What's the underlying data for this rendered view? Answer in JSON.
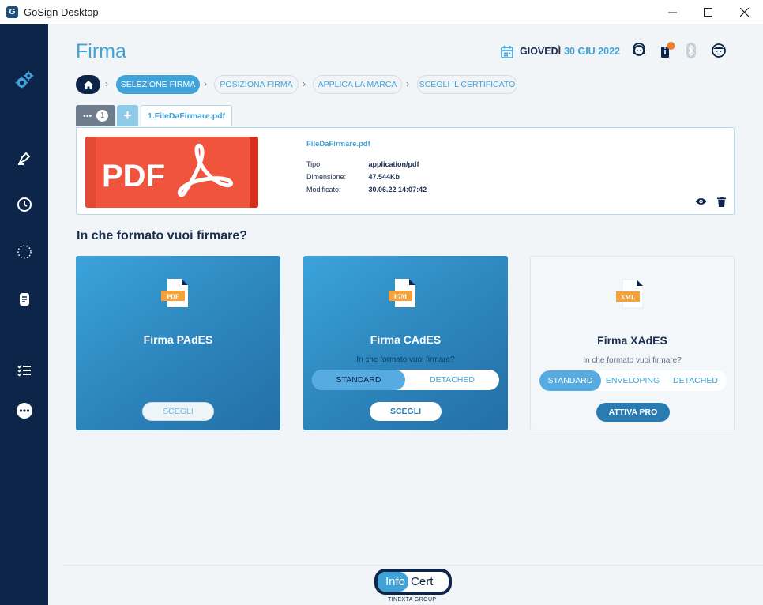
{
  "window": {
    "title": "GoSign Desktop",
    "app_icon_glyph": "G"
  },
  "header": {
    "title": "Firma",
    "date_day": "GIOVEDÌ",
    "date_value": "30 GIU 2022",
    "icons": [
      "calendar-icon",
      "support-agent-icon",
      "notifications-icon",
      "bluetooth-icon",
      "user-avatar-icon"
    ],
    "colors": {
      "accent": "#3fa2d8",
      "navy": "#0c2548",
      "badge": "#f07d2a"
    }
  },
  "breadcrumb": {
    "steps": [
      "SELEZIONE FIRMA",
      "POSIZIONA FIRMA",
      "APPLICA LA MARCA",
      "SCEGLI IL CERTIFICATO"
    ],
    "active_step": 0
  },
  "tabs": {
    "count": "1",
    "add_label": "+",
    "file_tab": "1.FileDaFirmare.pdf"
  },
  "file": {
    "thumb_label": "PDF",
    "name": "FileDaFirmare.pdf",
    "type_label": "Tipo:",
    "type_value": "application/pdf",
    "size_label": "Dimensione:",
    "size_value": "47.544Kb",
    "modified_label": "Modificato:",
    "modified_value": "30.06.22 14:07:42"
  },
  "question": "In che formato vuoi firmare?",
  "options": [
    {
      "title": "Firma PAdES",
      "icon_label": "PDF",
      "button": "SCEGLI"
    },
    {
      "title": "Firma CAdES",
      "icon_label": "P7M",
      "subtitle": "In che formato vuoi firmare?",
      "toggles": [
        "STANDARD",
        "DETACHED"
      ],
      "selected_toggle": 0,
      "button": "SCEGLI"
    },
    {
      "title": "Firma XAdES",
      "icon_label": "XML",
      "subtitle": "In che formato vuoi firmare?",
      "toggles": [
        "STANDARD",
        "ENVELOPING",
        "DETACHED"
      ],
      "selected_toggle": 0,
      "button": "ATTIVA PRO"
    }
  ],
  "footer": {
    "logo_info": "Info",
    "logo_cert": "Cert",
    "logo_sub": "TINEXTA GROUP"
  }
}
